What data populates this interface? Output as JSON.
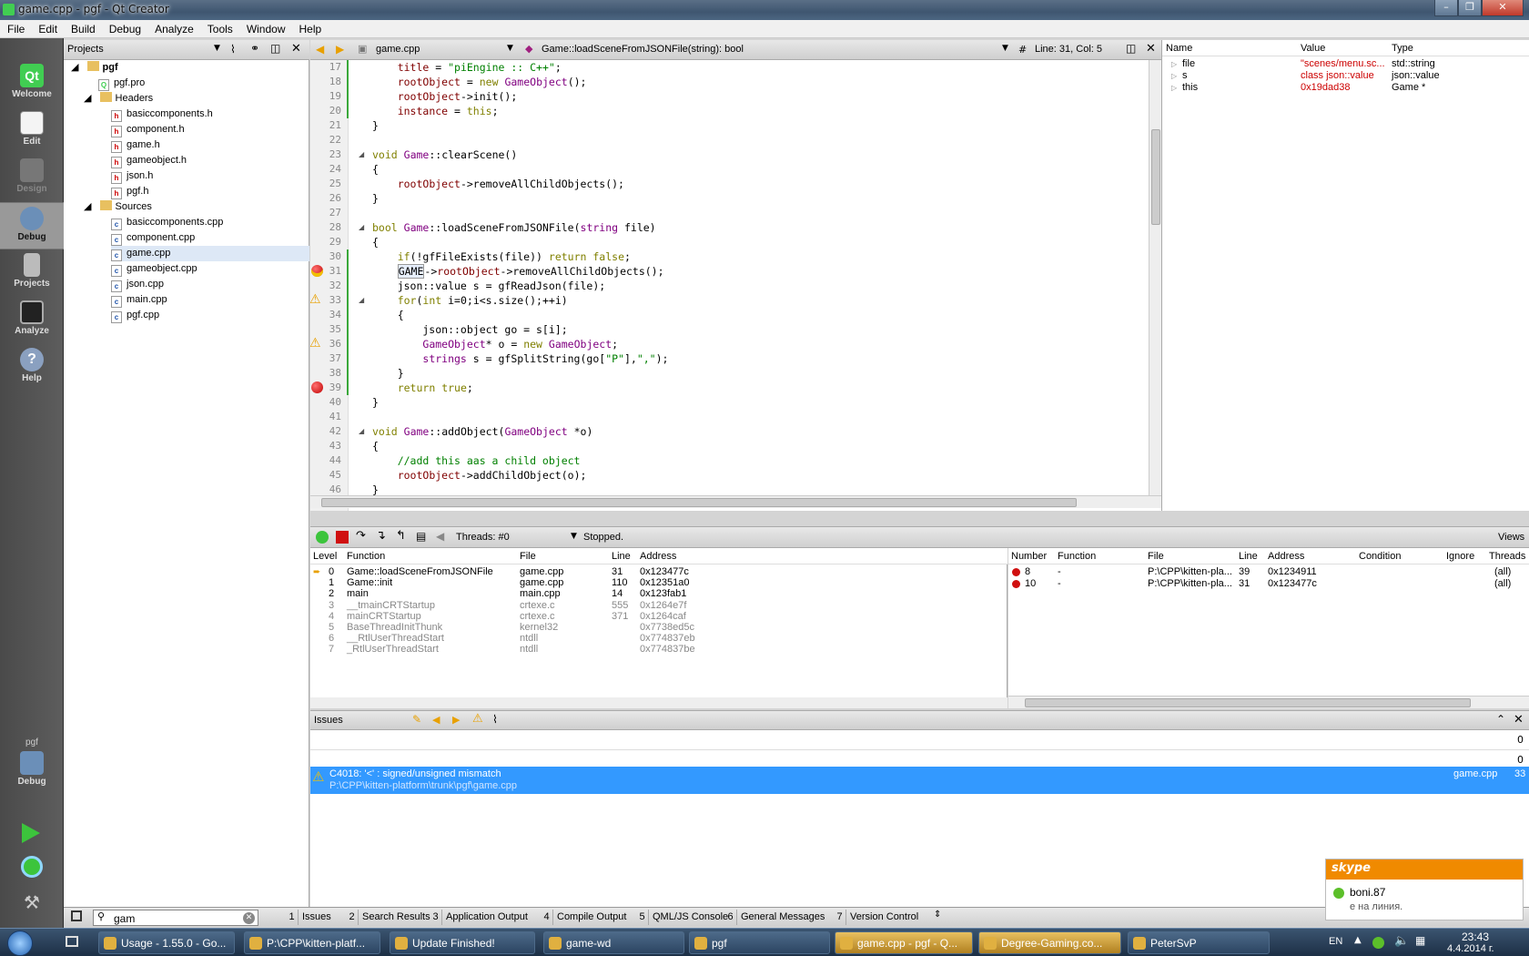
{
  "window": {
    "title": "game.cpp - pgf - Qt Creator"
  },
  "menu": [
    "File",
    "Edit",
    "Build",
    "Debug",
    "Analyze",
    "Tools",
    "Window",
    "Help"
  ],
  "modes": [
    {
      "label": "Welcome",
      "icon": "qt-logo-icon"
    },
    {
      "label": "Edit",
      "icon": "edit-document-icon"
    },
    {
      "label": "Design",
      "icon": "design-tools-icon"
    },
    {
      "label": "Debug",
      "icon": "debug-bug-icon"
    },
    {
      "label": "Projects",
      "icon": "projects-icon"
    },
    {
      "label": "Analyze",
      "icon": "analyze-monitor-icon"
    },
    {
      "label": "Help",
      "icon": "help-icon"
    }
  ],
  "kit": {
    "project": "pgf",
    "config": "Debug"
  },
  "projects": {
    "header": "Projects",
    "root": "pgf",
    "pro": "pgf.pro",
    "headers_label": "Headers",
    "headers": [
      "basiccomponents.h",
      "component.h",
      "game.h",
      "gameobject.h",
      "json.h",
      "pgf.h"
    ],
    "sources_label": "Sources",
    "sources": [
      "basiccomponents.cpp",
      "component.cpp",
      "game.cpp",
      "gameobject.cpp",
      "json.cpp",
      "main.cpp",
      "pgf.cpp"
    ]
  },
  "editor": {
    "file": "game.cpp",
    "symbol": "Game::loadSceneFromJSONFile(string): bool",
    "position": "Line: 31, Col: 5",
    "hash": "#"
  },
  "code_lines": [
    {
      "n": "17",
      "t": "    title = \"piEngine :: C++\";"
    },
    {
      "n": "18",
      "t": "    rootObject = new GameObject();"
    },
    {
      "n": "19",
      "t": "    rootObject->init();"
    },
    {
      "n": "20",
      "t": "    instance = this;"
    },
    {
      "n": "21",
      "t": "}"
    },
    {
      "n": "22",
      "t": ""
    },
    {
      "n": "23",
      "t": "void Game::clearScene()"
    },
    {
      "n": "24",
      "t": "{"
    },
    {
      "n": "25",
      "t": "    rootObject->removeAllChildObjects();"
    },
    {
      "n": "26",
      "t": "}"
    },
    {
      "n": "27",
      "t": ""
    },
    {
      "n": "28",
      "t": "bool Game::loadSceneFromJSONFile(string file)"
    },
    {
      "n": "29",
      "t": "{"
    },
    {
      "n": "30",
      "t": "    if(!gfFileExists(file)) return false;"
    },
    {
      "n": "31",
      "t": "    GAME->rootObject->removeAllChildObjects();"
    },
    {
      "n": "32",
      "t": "    json::value s = gfReadJson(file);"
    },
    {
      "n": "33",
      "t": "    for(int i=0;i<s.size();++i)"
    },
    {
      "n": "34",
      "t": "    {"
    },
    {
      "n": "35",
      "t": "        json::object go = s[i];"
    },
    {
      "n": "36",
      "t": "        GameObject* o = new GameObject;"
    },
    {
      "n": "37",
      "t": "        strings s = gfSplitString(go[\"P\"],\",\");"
    },
    {
      "n": "38",
      "t": "    }"
    },
    {
      "n": "39",
      "t": "    return true;"
    },
    {
      "n": "40",
      "t": "}"
    },
    {
      "n": "41",
      "t": ""
    },
    {
      "n": "42",
      "t": "void Game::addObject(GameObject *o)"
    },
    {
      "n": "43",
      "t": "{"
    },
    {
      "n": "44",
      "t": "    //add this aas a child object"
    },
    {
      "n": "45",
      "t": "    rootObject->addChildObject(o);"
    },
    {
      "n": "46",
      "t": "}"
    },
    {
      "n": "47",
      "t": ""
    }
  ],
  "locals": {
    "headers": [
      "Name",
      "Value",
      "Type"
    ],
    "rows": [
      {
        "name": "file",
        "value": "\"scenes/menu.sc...",
        "type": "std::string"
      },
      {
        "name": "s",
        "value": "class json::value",
        "type": "json::value"
      },
      {
        "name": "this",
        "value": "0x19dad38",
        "type": "Game *"
      }
    ]
  },
  "debugger": {
    "threads": "Threads: #0",
    "status": "Stopped.",
    "views": "Views"
  },
  "stack": {
    "headers": [
      "Level",
      "Function",
      "File",
      "Line",
      "Address"
    ],
    "rows": [
      {
        "level": "0",
        "func": "Game::loadSceneFromJSONFile",
        "file": "game.cpp",
        "line": "31",
        "addr": "0x123477c"
      },
      {
        "level": "1",
        "func": "Game::init",
        "file": "game.cpp",
        "line": "110",
        "addr": "0x12351a0"
      },
      {
        "level": "2",
        "func": "main",
        "file": "main.cpp",
        "line": "14",
        "addr": "0x123fab1"
      },
      {
        "level": "3",
        "func": "__tmainCRTStartup",
        "file": "crtexe.c",
        "line": "555",
        "addr": "0x1264e7f"
      },
      {
        "level": "4",
        "func": "mainCRTStartup",
        "file": "crtexe.c",
        "line": "371",
        "addr": "0x1264caf"
      },
      {
        "level": "5",
        "func": "BaseThreadInitThunk",
        "file": "kernel32",
        "line": "",
        "addr": "0x7738ed5c"
      },
      {
        "level": "6",
        "func": "__RtlUserThreadStart",
        "file": "ntdll",
        "line": "",
        "addr": "0x774837eb"
      },
      {
        "level": "7",
        "func": "_RtlUserThreadStart",
        "file": "ntdll",
        "line": "",
        "addr": "0x774837be"
      }
    ]
  },
  "breakpoints": {
    "headers": [
      "Number",
      "Function",
      "File",
      "Line",
      "Address",
      "Condition",
      "Ignore",
      "Threads"
    ],
    "rows": [
      {
        "num": "8",
        "func": "-",
        "file": "P:\\CPP\\kitten-pla...",
        "line": "39",
        "addr": "0x1234911",
        "threads": "(all)"
      },
      {
        "num": "10",
        "func": "-",
        "file": "P:\\CPP\\kitten-pla...",
        "line": "31",
        "addr": "0x123477c",
        "threads": "(all)"
      }
    ]
  },
  "issues": {
    "header": "Issues",
    "count1": "0",
    "count2": "0",
    "message": "C4018: '<' : signed/unsigned mismatch",
    "path": "P:\\CPP\\kitten-platform\\trunk\\pgf\\game.cpp",
    "file": "game.cpp",
    "line": "33"
  },
  "output_tabs": [
    {
      "n": "1",
      "label": "Issues"
    },
    {
      "n": "2",
      "label": "Search Results"
    },
    {
      "n": "3",
      "label": "Application Output"
    },
    {
      "n": "4",
      "label": "Compile Output"
    },
    {
      "n": "5",
      "label": "QML/JS Console"
    },
    {
      "n": "6",
      "label": "General Messages"
    },
    {
      "n": "7",
      "label": "Version Control"
    }
  ],
  "locator": {
    "value": "gam"
  },
  "taskbar": {
    "tasks": [
      "Usage - 1.55.0 - Go...",
      "P:\\CPP\\kitten-platf...",
      "Update Finished!",
      "game-wd",
      "pgf",
      "game.cpp - pgf - Q...",
      "Degree-Gaming.co...",
      "PeterSvP"
    ],
    "lang": "EN",
    "time": "23:43",
    "date": "4.4.2014 г."
  },
  "skype": {
    "brand": "skype",
    "user": "boni.87",
    "status": "е на линия."
  },
  "colors": {
    "selection": "#3399ff",
    "accent": "#f08a00"
  }
}
